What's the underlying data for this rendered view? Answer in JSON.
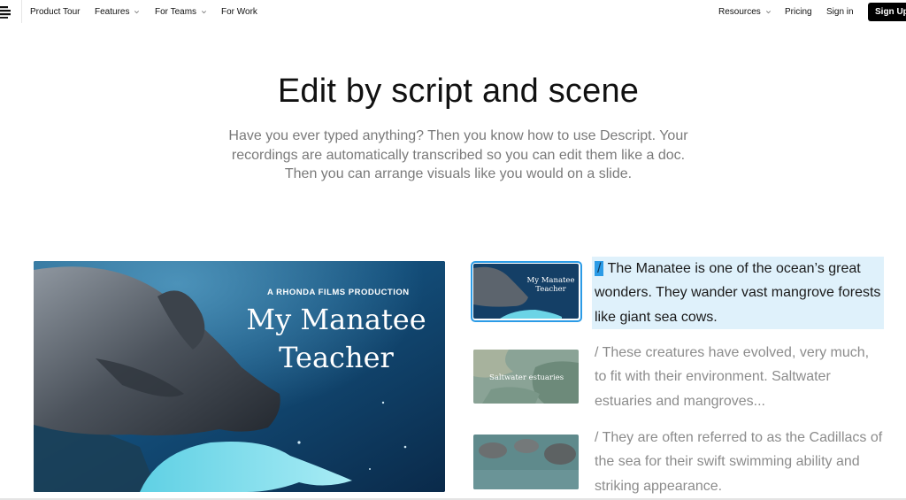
{
  "nav": {
    "logo_icon": "descript-logo-icon",
    "items": [
      {
        "label": "Product Tour",
        "has_dropdown": false
      },
      {
        "label": "Features",
        "has_dropdown": true
      },
      {
        "label": "For Teams",
        "has_dropdown": true
      },
      {
        "label": "For Work",
        "has_dropdown": false
      }
    ],
    "right_items": [
      {
        "label": "Resources",
        "has_dropdown": true
      },
      {
        "label": "Pricing",
        "has_dropdown": false
      },
      {
        "label": "Sign in",
        "has_dropdown": false
      }
    ],
    "signup_label": "Sign Up"
  },
  "hero": {
    "title": "Edit by script and scene",
    "subtitle": "Have you ever typed anything? Then you know how to use Descript. Your recordings are automatically transcribed so you can edit them like a doc. Then you can arrange visuals like you would on a slide."
  },
  "video": {
    "production": "A RHONDA FILMS PRODUCTION",
    "title_line1": "My Manatee",
    "title_line2": "Teacher"
  },
  "scenes": [
    {
      "thumb_caption": "My Manatee Teacher",
      "selected": true,
      "slash": "/",
      "text": "The Manatee is one of the ocean’s great wonders. They wander vast mangrove forests like giant sea cows."
    },
    {
      "thumb_caption": "Saltwater estuaries",
      "selected": false,
      "slash": "/",
      "text": "These creatures have evolved, very much, to fit with their environment. Saltwater estuaries and mangroves..."
    },
    {
      "thumb_caption": "",
      "selected": false,
      "slash": "/",
      "text": "They are often referred to as the Cadillacs of the sea for their swift swimming ability and striking appearance."
    }
  ],
  "colors": {
    "accent": "#2b9be6",
    "highlight": "#dff1fb",
    "muted_text": "#8c8c8c",
    "button_bg": "#000000"
  }
}
